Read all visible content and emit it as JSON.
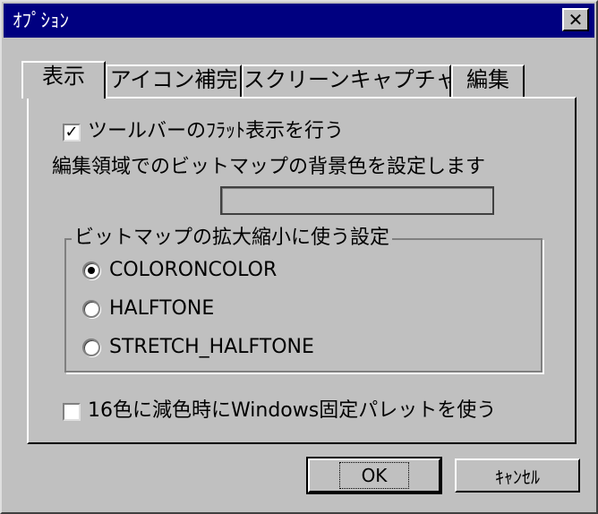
{
  "window": {
    "title": "ｵﾌﾟｼｮﾝ",
    "close_glyph": "✕"
  },
  "tabs": [
    {
      "label": "表示",
      "active": true
    },
    {
      "label": "アイコン補完",
      "active": false
    },
    {
      "label": "スクリーンキャプチャ",
      "active": false
    },
    {
      "label": "編集",
      "active": false
    }
  ],
  "display": {
    "flat_toolbar": {
      "label": "ツールバーのﾌﾗｯﾄ表示を行う",
      "checked": true
    },
    "bg_color_label": "編集領域でのビットマップの背景色を設定します",
    "scaling_group": {
      "caption": "ビットマップの拡大縮小に使う設定",
      "options": [
        {
          "label": "COLORONCOLOR",
          "selected": true
        },
        {
          "label": "HALFTONE",
          "selected": false
        },
        {
          "label": "STRETCH_HALFTONE",
          "selected": false
        }
      ]
    },
    "fixed_palette": {
      "label": "16色に減色時にWindows固定パレットを使う",
      "checked": false
    }
  },
  "buttons": {
    "ok": "OK",
    "cancel": "ｷｬﾝｾﾙ"
  },
  "colors": {
    "face": "#c0c0c0",
    "title_bar": "#000080"
  }
}
